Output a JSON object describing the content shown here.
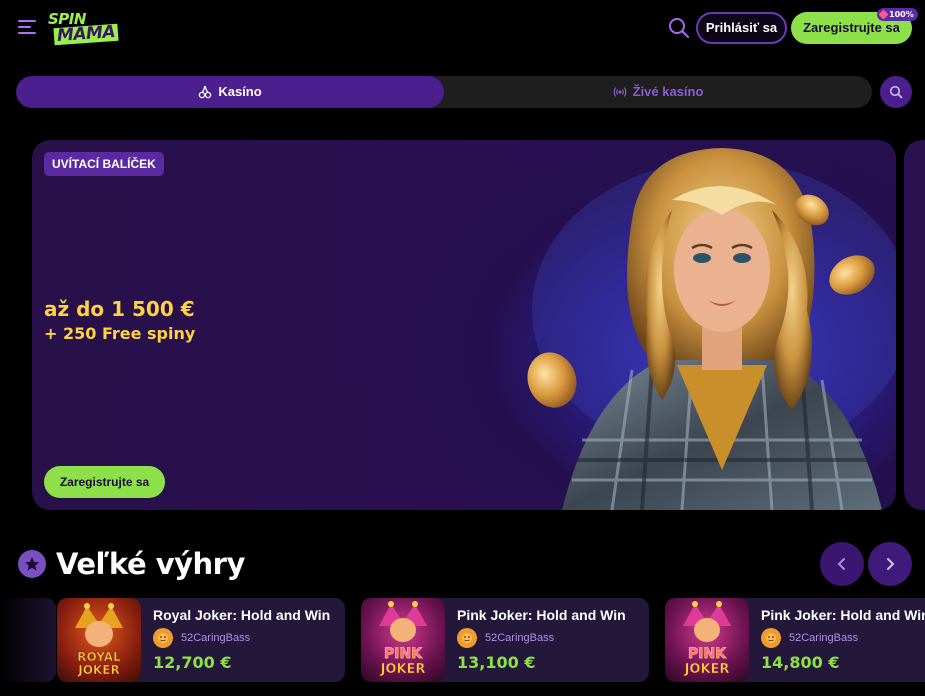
{
  "header": {
    "logo_line1": "SPIN",
    "logo_line2": "MAMA",
    "login_label": "Prihlásiť sa",
    "register_label": "Zaregistrujte sa",
    "badge_text": "100%"
  },
  "tabs": [
    {
      "label": "Kasíno",
      "icon": "cherry-icon",
      "active": true
    },
    {
      "label": "Živé kasíno",
      "icon": "live-broadcast-icon",
      "active": false
    }
  ],
  "banner": {
    "tag": "UVÍTACÍ BALÍČEK",
    "amount": "až do 1 500 €",
    "spins": "+ 250 Free spiny",
    "cta": "Zaregistrujte sa"
  },
  "big_wins": {
    "title": "Veľké výhry",
    "items": [
      {
        "game": "Royal Joker: Hold and Win",
        "user": "52CaringBass",
        "amount": "12,700 €",
        "thumb_text1": "ROYAL",
        "thumb_text2": "JOKER"
      },
      {
        "game": "Pink Joker: Hold and Win",
        "user": "52CaringBass",
        "amount": "13,100 €",
        "thumb_text1": "PINK",
        "thumb_text2": "JOKER"
      },
      {
        "game": "Pink Joker: Hold and Win",
        "user": "52CaringBass",
        "amount": "14,800 €",
        "thumb_text1": "PINK",
        "thumb_text2": "JOKER"
      }
    ]
  },
  "colors": {
    "accent_green": "#8ee04a",
    "accent_purple": "#4b1f8e",
    "gold": "#ffd23f"
  }
}
